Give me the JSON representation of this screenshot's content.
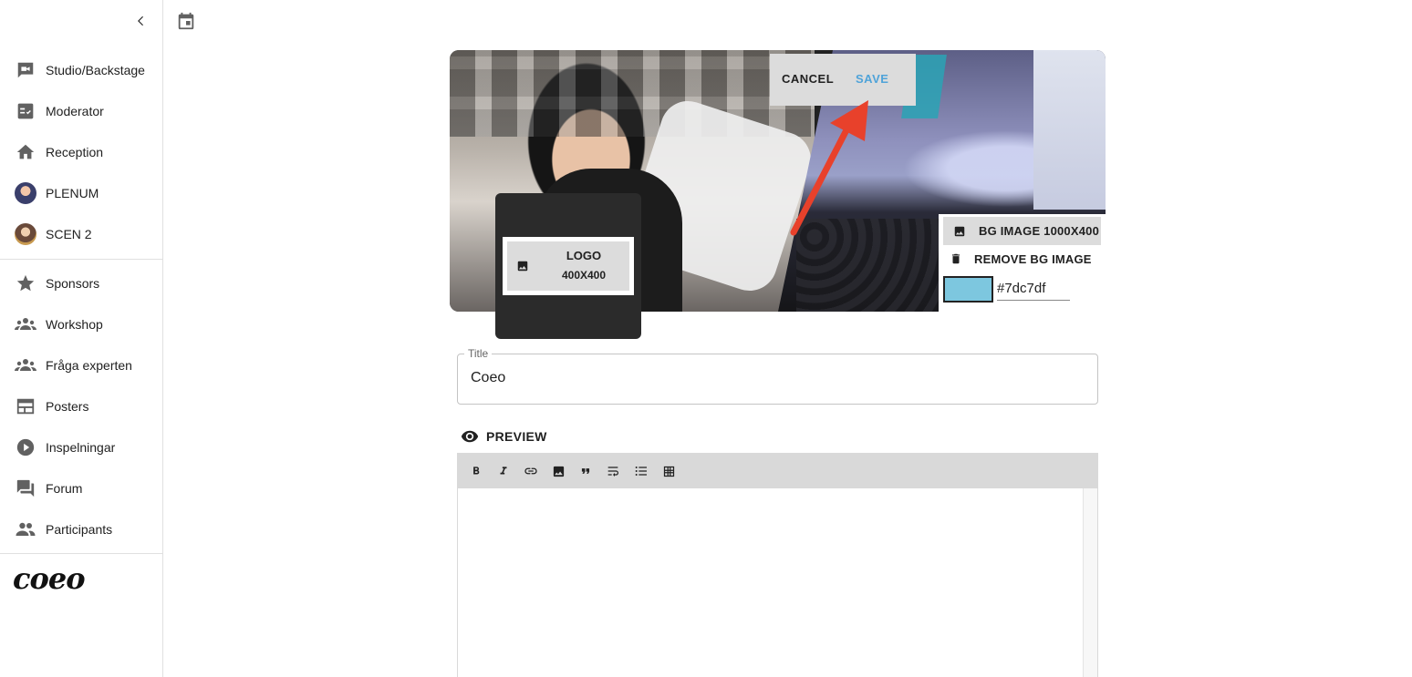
{
  "sidebar": {
    "collapse_icon": "chevron-left-icon",
    "items": [
      {
        "label": "Studio/Backstage",
        "icon": "videocam-chat-icon"
      },
      {
        "label": "Moderator",
        "icon": "checklist-icon"
      },
      {
        "label": "Reception",
        "icon": "home-icon"
      },
      {
        "label": "PLENUM",
        "icon": "avatar"
      },
      {
        "label": "SCEN 2",
        "icon": "avatar"
      },
      {
        "label": "Sponsors",
        "icon": "star-icon"
      },
      {
        "label": "Workshop",
        "icon": "groups-icon"
      },
      {
        "label": "Fråga experten",
        "icon": "groups-icon"
      },
      {
        "label": "Posters",
        "icon": "web-layout-icon"
      },
      {
        "label": "Inspelningar",
        "icon": "play-circle-icon"
      },
      {
        "label": "Forum",
        "icon": "forum-icon"
      },
      {
        "label": "Participants",
        "icon": "people-icon"
      }
    ],
    "brand": "coeo"
  },
  "topbar": {
    "calendar_icon": "calendar-icon"
  },
  "banner": {
    "cancel_label": "CANCEL",
    "save_label": "SAVE",
    "logo_line1": "LOGO",
    "logo_line2": "400X400",
    "bg_image_label": "BG IMAGE 1000X400",
    "remove_bg_label": "REMOVE BG IMAGE",
    "bg_color_hex": "#7dc7df",
    "bg_color_value": "#7dc7df"
  },
  "form": {
    "title_label": "Title",
    "title_value": "Coeo",
    "preview_label": "PREVIEW"
  },
  "editor": {
    "toolbar": [
      "bold-icon",
      "italic-icon",
      "link-icon",
      "image-icon",
      "quote-icon",
      "wrap-text-icon",
      "bulleted-list-icon",
      "table-icon"
    ]
  },
  "colors": {
    "save_accent": "#4fa3d9",
    "annotation_arrow": "#e8412b",
    "toolbar_bg": "#d9d9d9"
  }
}
